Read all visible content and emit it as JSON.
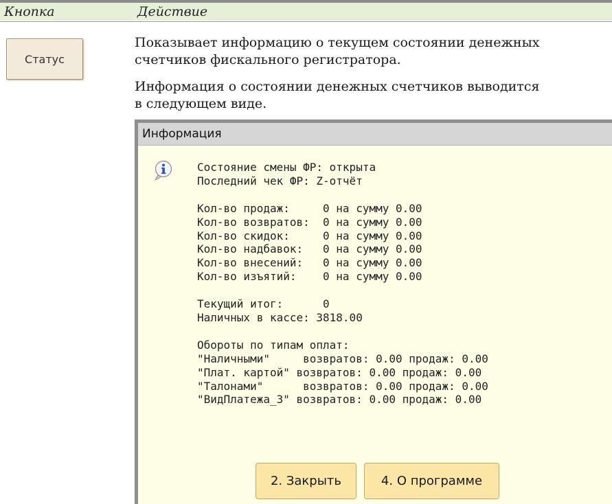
{
  "table": {
    "col_button": "Кнопка",
    "col_action": "Действие"
  },
  "status_button": {
    "label": "Статус"
  },
  "description": {
    "line1": "Показывает информацию о текущем состоянии денежных",
    "line2": "счетчиков фискального регистратора.",
    "line3": "Информация о состоянии денежных счетчиков выводится",
    "line4": "в следующем виде."
  },
  "dialog": {
    "title": "Информация",
    "icon": "info-icon",
    "lines": [
      "Состояние смены ФР: открыта",
      "Последний чек ФР: Z-отчёт",
      "",
      "Кол-во продаж:     0 на сумму 0.00",
      "Кол-во возвратов:  0 на сумму 0.00",
      "Кол-во скидок:     0 на сумму 0.00",
      "Кол-во надбавок:   0 на сумму 0.00",
      "Кол-во внесений:   0 на сумму 0.00",
      "Кол-во изъятий:    0 на сумму 0.00",
      "",
      "Текущий итог:      0",
      "Наличных в кассе: 3818.00",
      "",
      "Обороты по типам оплат:",
      "\"Наличными\"     возвратов: 0.00 продаж: 0.00",
      "\"Плат. картой\" возвратов: 0.00 продаж: 0.00",
      "\"Талонами\"      возвратов: 0.00 продаж: 0.00",
      "\"ВидПлатежа_3\" возвратов: 0.00 продаж: 0.00"
    ],
    "close_button": "2. Закрыть",
    "about_button": "4. О программе"
  }
}
